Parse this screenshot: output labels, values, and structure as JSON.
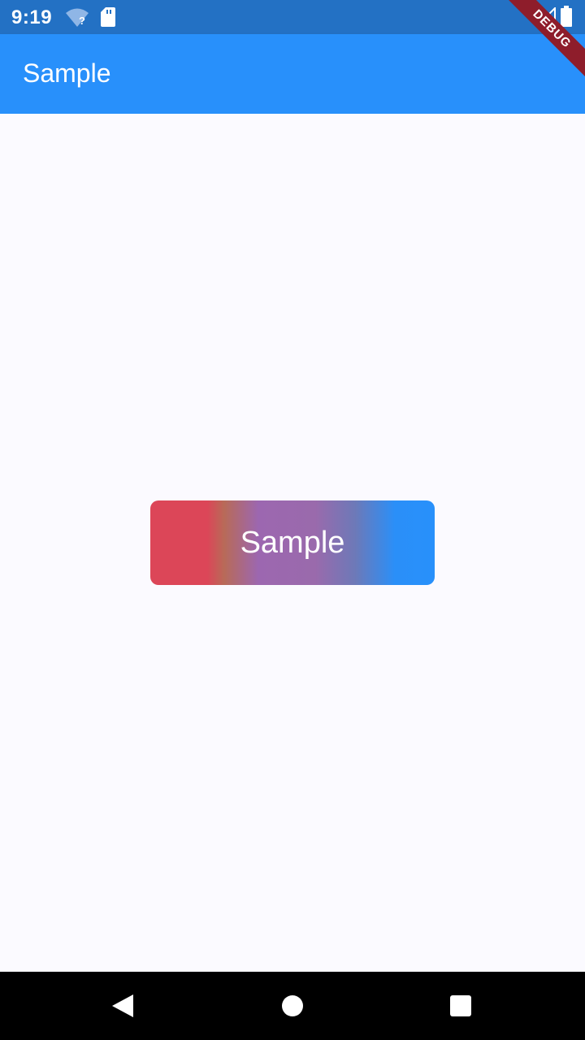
{
  "status_bar": {
    "time": "9:19",
    "icons": [
      "wifi-icon",
      "sd-card-icon",
      "signal-icon",
      "battery-icon"
    ]
  },
  "app_bar": {
    "title": "Sample"
  },
  "main": {
    "button_label": "Sample"
  },
  "debug_banner": {
    "label": "DEBUG"
  },
  "nav_bar": {
    "icons": [
      "back-icon",
      "home-icon",
      "recents-icon"
    ]
  },
  "colors": {
    "status_bar": "#2371c4",
    "app_bar": "#2890fb",
    "background": "#fbfaff",
    "gradient_start": "#dc4658",
    "gradient_mid": "#9c67b0",
    "gradient_end": "#2890fb",
    "debug_banner": "#8e1d2b"
  }
}
